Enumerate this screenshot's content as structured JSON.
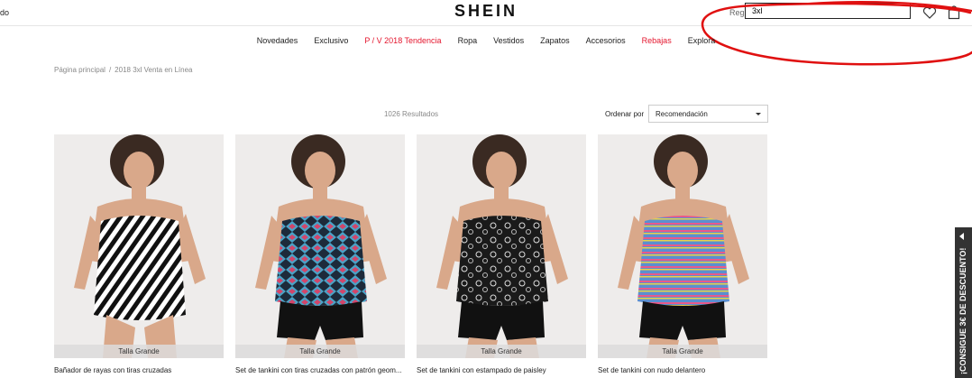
{
  "header": {
    "top_left_text": "do",
    "logo": "SHEIN",
    "region_label": "Regi",
    "search_value": "3xl"
  },
  "nav": {
    "items": [
      {
        "label": "Novedades",
        "highlight": false
      },
      {
        "label": "Exclusivo",
        "highlight": false
      },
      {
        "label": "P / V 2018 Tendencia",
        "highlight": true
      },
      {
        "label": "Ropa",
        "highlight": false
      },
      {
        "label": "Vestidos",
        "highlight": false
      },
      {
        "label": "Zapatos",
        "highlight": false
      },
      {
        "label": "Accesorios",
        "highlight": false
      },
      {
        "label": "Rebajas",
        "highlight": true
      },
      {
        "label": "Explora",
        "highlight": false
      }
    ]
  },
  "breadcrumb": {
    "home": "Página principal",
    "separator": "/",
    "current": "2018 3xl Venta en Línea"
  },
  "toolbar": {
    "results": "1026 Resultados",
    "sort_label": "Ordenar por",
    "sort_value": "Recomendación"
  },
  "products": [
    {
      "badge": "Talla Grande",
      "title": "Bañador de rayas con tiras cruzadas",
      "pattern": "stripes"
    },
    {
      "badge": "Talla Grande",
      "title": "Set de tankini con tiras cruzadas con patrón geom...",
      "pattern": "geometric"
    },
    {
      "badge": "Talla Grande",
      "title": "Set de tankini con estampado de paisley",
      "pattern": "paisley"
    },
    {
      "badge": "Talla Grande",
      "title": "Set de tankini con nudo delantero",
      "pattern": "multicolor"
    }
  ],
  "side_tab": {
    "label": "¡CONSIGUE 3€ DE DESCUENTO!"
  },
  "colors": {
    "accent_red": "#e4162e",
    "annotation_red": "#e01010",
    "side_tab_bg": "#333333"
  },
  "icons": [
    "heart-icon",
    "bag-icon",
    "caret-down-icon",
    "chevron-left-icon"
  ]
}
